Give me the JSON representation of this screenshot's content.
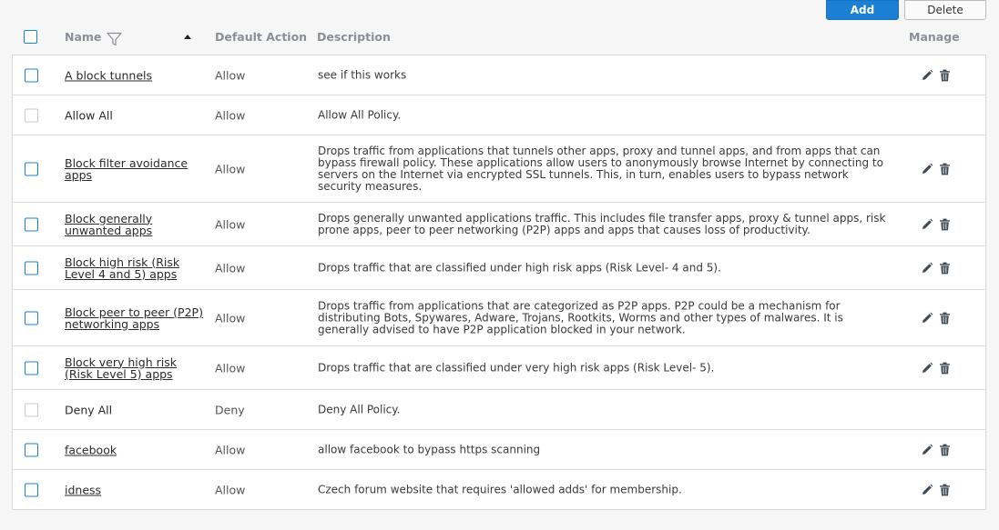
{
  "toolbar": {
    "add_label": "Add",
    "delete_label": "Delete"
  },
  "columns": {
    "name": "Name",
    "default_action": "Default Action",
    "description": "Description",
    "manage": "Manage"
  },
  "colors": {
    "accent": "#1b7fd4",
    "disabled_checkbox": "#c9c9c9"
  },
  "rows": [
    {
      "name": "A block tunnels",
      "action": "Allow",
      "description": "see if this works",
      "editable": true
    },
    {
      "name": "Allow All",
      "action": "Allow",
      "description": "Allow All Policy.",
      "editable": false
    },
    {
      "name": "Block filter avoidance apps",
      "action": "Allow",
      "description": "Drops traffic from applications that tunnels other apps, proxy and tunnel apps, and from apps that can bypass firewall policy. These applications allow users to anonymously browse Internet by connecting to servers on the Internet via encrypted SSL tunnels. This, in turn, enables users to bypass network security measures.",
      "editable": true
    },
    {
      "name": "Block generally unwanted apps",
      "action": "Allow",
      "description": "Drops generally unwanted applications traffic. This includes file transfer apps, proxy & tunnel apps, risk prone apps, peer to peer networking (P2P) apps and apps that causes loss of productivity.",
      "editable": true
    },
    {
      "name": "Block high risk (Risk Level 4 and 5) apps",
      "action": "Allow",
      "description": "Drops traffic that are classified under high risk apps (Risk Level- 4 and 5).",
      "editable": true
    },
    {
      "name": "Block peer to peer (P2P) networking apps",
      "action": "Allow",
      "description": "Drops traffic from applications that are categorized as P2P apps. P2P could be a mechanism for distributing Bots, Spywares, Adware, Trojans, Rootkits, Worms and other types of malwares. It is generally advised to have P2P application blocked in your network.",
      "editable": true
    },
    {
      "name": "Block very high risk (Risk Level 5) apps",
      "action": "Allow",
      "description": "Drops traffic that are classified under very high risk apps (Risk Level- 5).",
      "editable": true
    },
    {
      "name": "Deny All",
      "action": "Deny",
      "description": "Deny All Policy.",
      "editable": false
    },
    {
      "name": "facebook",
      "action": "Allow",
      "description": "allow facebook to bypass https scanning",
      "editable": true
    },
    {
      "name": "idness",
      "action": "Allow",
      "description": "Czech forum website that requires 'allowed adds' for membership.",
      "editable": true
    }
  ]
}
